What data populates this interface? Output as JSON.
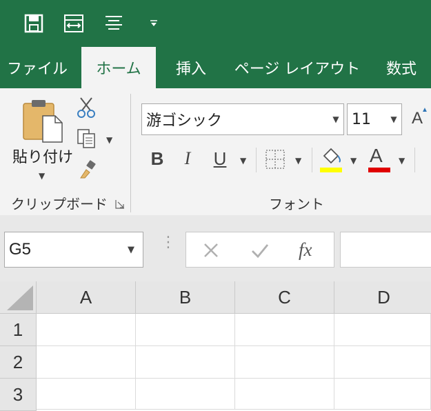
{
  "tabs": [
    {
      "label": "ファイル",
      "active": false
    },
    {
      "label": "ホーム",
      "active": true
    },
    {
      "label": "挿入",
      "active": false
    },
    {
      "label": "ページ レイアウト",
      "active": false
    },
    {
      "label": "数式",
      "active": false
    }
  ],
  "quick_access": {
    "icons": [
      "save-icon",
      "fit-columns-icon",
      "align-icon",
      "customize-dropdown-icon"
    ]
  },
  "clipboard": {
    "paste_label": "貼り付け",
    "group_label": "クリップボード",
    "icons": [
      "paste-icon",
      "cut-icon",
      "copy-icon",
      "format-painter-icon",
      "dialog-launcher-icon"
    ]
  },
  "font": {
    "name": "游ゴシック",
    "size": "11",
    "group_label": "フォント",
    "bold": "B",
    "italic": "I",
    "underline": "U",
    "font_color_glyph": "A",
    "grow_glyph": "A",
    "fill_color": "#ffff00",
    "font_color": "#e00000"
  },
  "formula_bar": {
    "name_box": "G5",
    "fx": "fx",
    "formula": ""
  },
  "sheet": {
    "columns": [
      "A",
      "B",
      "C",
      "D"
    ],
    "rows": [
      "1",
      "2",
      "3"
    ]
  },
  "colors": {
    "accent": "#217346",
    "ribbon": "#f3f3f3"
  }
}
